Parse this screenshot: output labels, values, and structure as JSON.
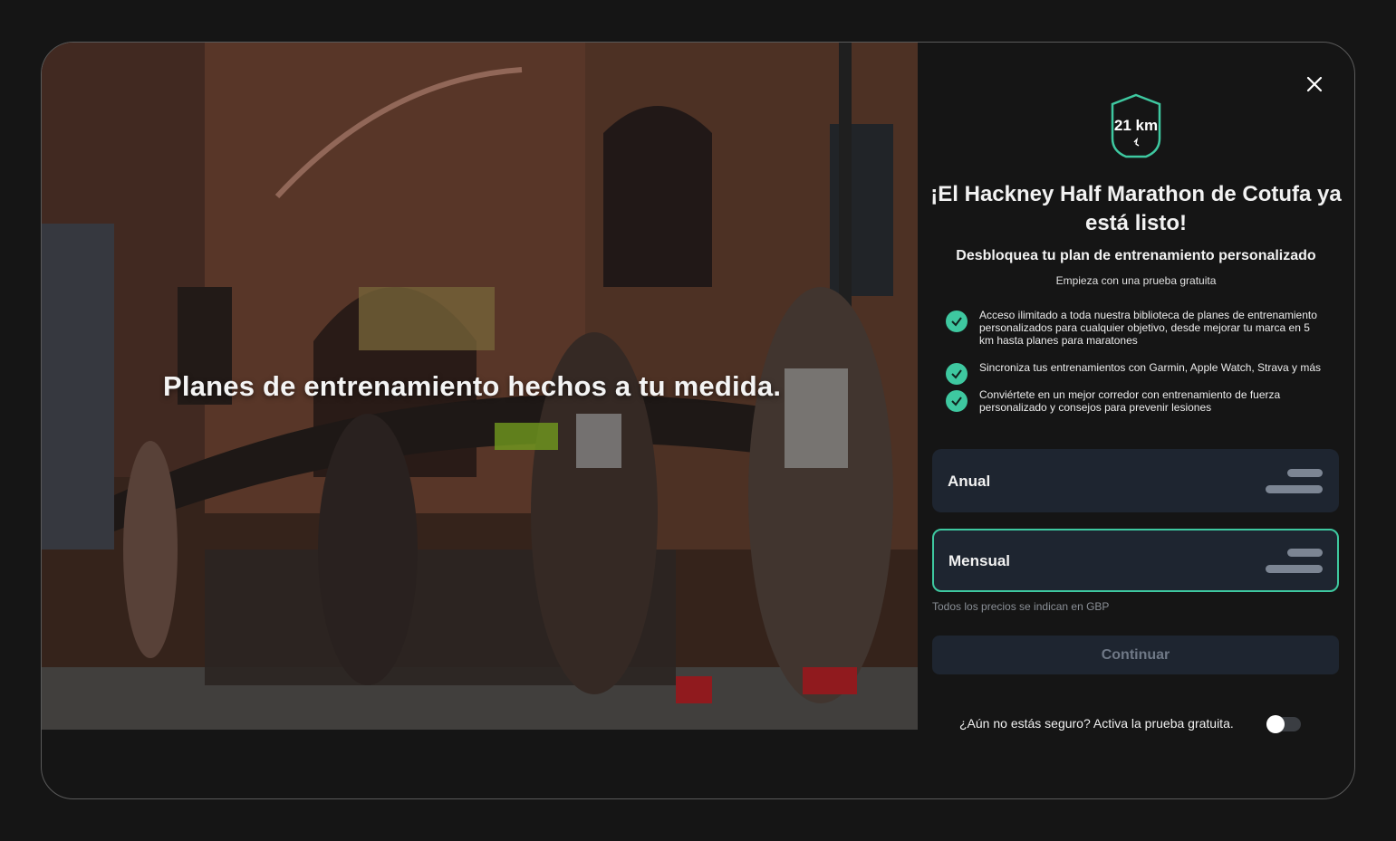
{
  "hero": {
    "headline": "Planes de entrenamiento hechos a tu medida."
  },
  "panel": {
    "close_icon": "close-icon",
    "badge": {
      "icon": "shield-badge-icon",
      "distance": "21 km",
      "accent": "#3ec8a0"
    },
    "title": "¡El Hackney Half Marathon de Cotufa ya está listo!",
    "subtitle": "Desbloquea tu plan de entrenamiento personalizado",
    "trial_note": "Empieza con una prueba gratuita",
    "features": [
      "Acceso ilimitado a toda nuestra biblioteca de planes de entrenamiento personalizados para cualquier objetivo, desde mejorar tu marca en 5 km hasta planes para maratones",
      "Sincroniza tus entrenamientos con Garmin, Apple Watch, Strava y más",
      "Conviértete en un mejor corredor con entrenamiento de fuerza personalizado y consejos para prevenir lesiones"
    ],
    "plans": [
      {
        "label": "Anual",
        "selected": false
      },
      {
        "label": "Mensual",
        "selected": true
      }
    ],
    "currency_note": "Todos los precios se indican en GBP",
    "continue_label": "Continuar",
    "trial_toggle": {
      "label": "¿Aún no estás seguro? Activa la prueba gratuita.",
      "enabled": false
    }
  },
  "colors": {
    "background": "#151515",
    "accent": "#3ec8a0",
    "card": "#1e2530"
  }
}
